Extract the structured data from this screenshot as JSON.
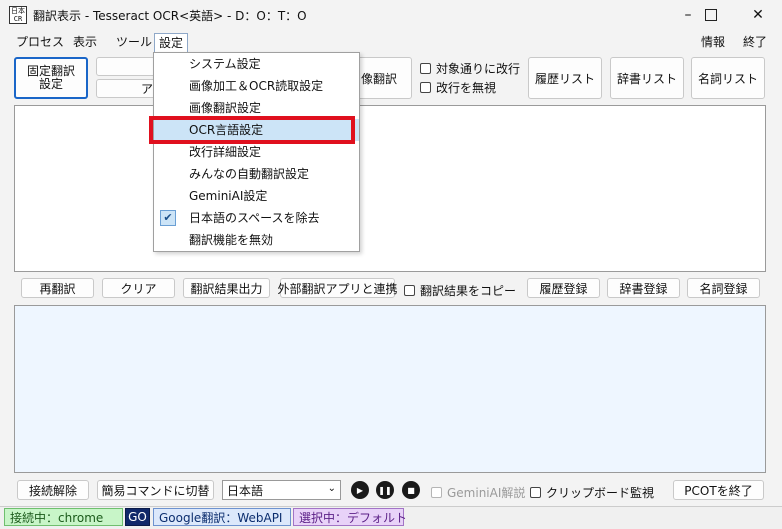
{
  "window": {
    "title": "翻訳表示 - Tesseract OCR<英語> - D：O：T：O",
    "app_icon_text": "日本\nCR",
    "minimize_icon": "minimize-icon",
    "maximize_icon": "maximize-icon",
    "close_icon": "close-icon"
  },
  "menubar": {
    "process": "プロセス",
    "view": "表示",
    "tools": "ツール",
    "settings": "設定",
    "info": "情報",
    "exit": "終了"
  },
  "settings_menu": {
    "items": [
      "システム設定",
      "画像加工＆OCR読取設定",
      "画像翻訳設定",
      "OCR言語設定",
      "改行詳細設定",
      "みんなの自動翻訳設定",
      "GeminiAI設定",
      "日本語のスペースを除去",
      "翻訳機能を無効"
    ],
    "highlighted": "OCR言語設定",
    "checked": "日本語のスペースを除去"
  },
  "toolbar": {
    "fixed_translate": "固定翻訳\n設定",
    "hidden_button_fragment": "ア",
    "image_translate": "画像翻訳",
    "line_break_check": "対象通りに改行",
    "ignore_break_check": "改行を無視",
    "history_list": "履歴リスト",
    "dict_list": "辞書リスト",
    "noun_list": "名詞リスト"
  },
  "action_bar": {
    "retranslate": "再翻訳",
    "clear": "クリア",
    "output": "翻訳結果出力",
    "external": "外部翻訳アプリと連携",
    "copy_check": "翻訳結果をコピー",
    "history_reg": "履歴登録",
    "dict_reg": "辞書登録",
    "noun_reg": "名詞登録"
  },
  "bottom_bar": {
    "disconnect": "接続解除",
    "simple_cmd": "簡易コマンドに切替",
    "language_value": "日本語",
    "gemini_check": "GeminiAI解説",
    "clipboard_check": "クリップボード監視",
    "pcot_exit": "PCOTを終了"
  },
  "statusbar": {
    "connecting": "接続中：chrome",
    "go": "GO",
    "google": "Google翻訳：WebAPI",
    "selecting": "選択中：デフォルト"
  },
  "colors": {
    "connect_bg": "#c8f5c8",
    "go_bg": "#10286a",
    "google_bg": "#dce8fb",
    "select_bg": "#e8d2f8",
    "highlight_red": "#e0101e"
  }
}
